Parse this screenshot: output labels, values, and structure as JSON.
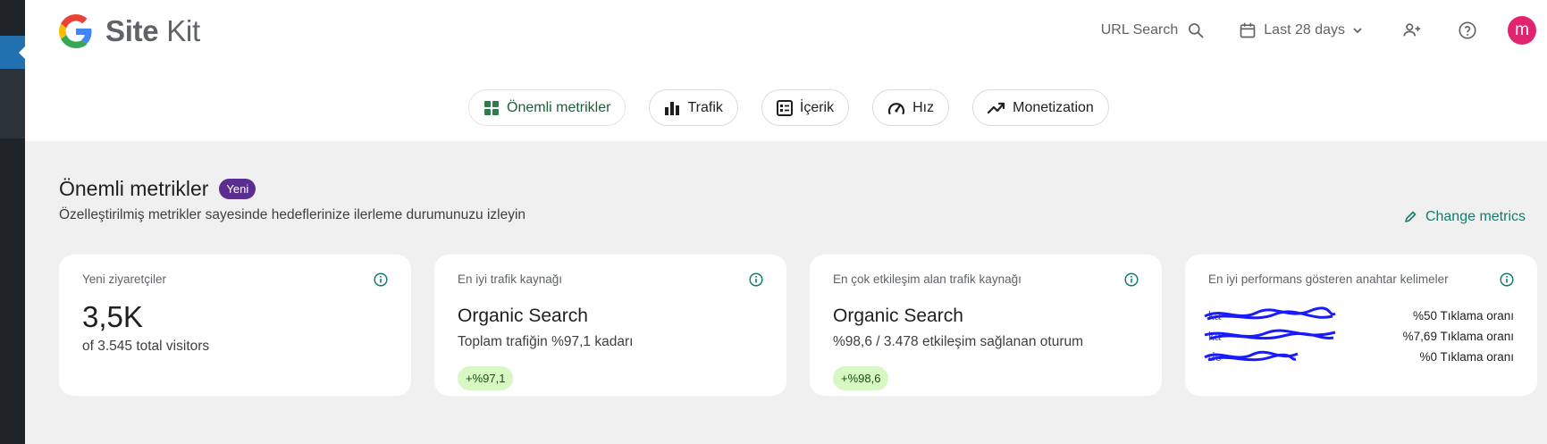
{
  "brand": {
    "name_bold": "Site",
    "name_rest": " Kit"
  },
  "header": {
    "url_search_label": "URL Search",
    "date_range_label": "Last 28 days",
    "avatar_initial": "m"
  },
  "nav": {
    "chips": [
      {
        "label": "Önemli metrikler"
      },
      {
        "label": "Trafik"
      },
      {
        "label": "İçerik"
      },
      {
        "label": "Hız"
      },
      {
        "label": "Monetization"
      }
    ]
  },
  "section": {
    "title": "Önemli metrikler",
    "badge": "Yeni",
    "subtitle": "Özelleştirilmiş metrikler sayesinde hedeflerinize ilerleme durumunuzu izleyin",
    "change_metrics_label": "Change metrics"
  },
  "cards": [
    {
      "label": "Yeni ziyaretçiler",
      "big": "3,5K",
      "sub": "of 3.545 total visitors"
    },
    {
      "label": "En iyi trafik kaynağı",
      "title": "Organic Search",
      "desc": "Toplam trafiğin %97,1 kadarı",
      "pill": "+%97,1"
    },
    {
      "label": "En çok etkileşim alan trafik kaynağı",
      "title": "Organic Search",
      "desc": "%98,6 / 3.478 etkileşim sağlanan oturum",
      "pill": "+%98,6"
    },
    {
      "label": "En iyi performans gösteren anahtar kelimeler",
      "keywords": [
        {
          "keyword": "ka",
          "value": "%50 Tıklama oranı"
        },
        {
          "keyword": "ka",
          "value": "%7,69 Tıklama oranı"
        },
        {
          "keyword": "de",
          "value": "%0 Tıklama oranı"
        }
      ]
    }
  ],
  "colors": {
    "accent_green": "#137c6e",
    "badge_purple": "#5c2d91",
    "pill_green": "#d7f7c3",
    "avatar": "#e0246f",
    "wp_blue": "#2271b1"
  }
}
